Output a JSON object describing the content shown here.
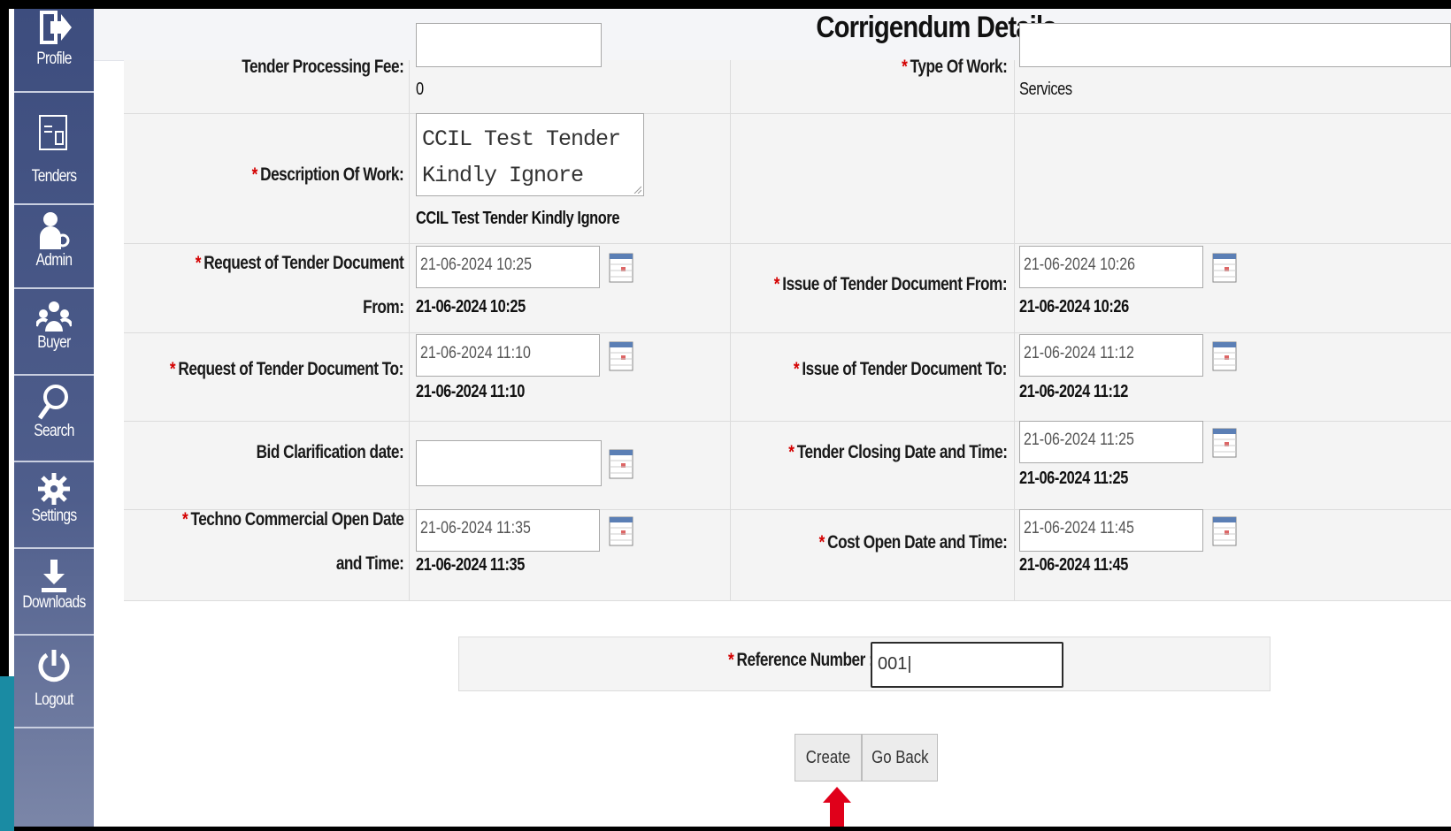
{
  "header": {
    "title": "Corrigendum Details"
  },
  "sidebar": {
    "items": [
      {
        "label": "Profile",
        "icon": "profile-icon"
      },
      {
        "label": "Tenders",
        "icon": "tenders-icon"
      },
      {
        "label": "Admin",
        "icon": "admin-icon"
      },
      {
        "label": "Buyer",
        "icon": "buyer-icon"
      },
      {
        "label": "Search",
        "icon": "search-icon"
      },
      {
        "label": "Settings",
        "icon": "settings-icon"
      },
      {
        "label": "Downloads",
        "icon": "downloads-icon"
      },
      {
        "label": "Logout",
        "icon": "logout-icon"
      }
    ]
  },
  "form": {
    "processing_fee": {
      "label": "Tender Processing Fee:",
      "value": "0"
    },
    "type_of_work": {
      "label": "Type Of Work:",
      "value": "Services"
    },
    "description": {
      "label": "Description Of Work:",
      "input_line1": "CCIL Test Tender",
      "input_line2": "Kindly Ignore",
      "value": "CCIL Test Tender Kindly Ignore"
    },
    "req_from": {
      "label_line1": "Request of Tender Document",
      "label_line2": "From:",
      "input": "21-06-2024 10:25",
      "value": "21-06-2024 10:25"
    },
    "issue_from": {
      "label": "Issue of Tender Document From:",
      "input": "21-06-2024 10:26",
      "value": "21-06-2024 10:26"
    },
    "req_to": {
      "label": "Request of Tender Document To:",
      "input": "21-06-2024 11:10",
      "value": "21-06-2024 11:10"
    },
    "issue_to": {
      "label": "Issue of Tender Document To:",
      "input": "21-06-2024 11:12",
      "value": "21-06-2024 11:12"
    },
    "bid_clarification": {
      "label": "Bid Clarification date:",
      "input": ""
    },
    "closing": {
      "label": "Tender Closing Date and Time:",
      "input": "21-06-2024 11:25",
      "value": "21-06-2024 11:25"
    },
    "techno_open": {
      "label_line1": "Techno Commercial Open Date",
      "label_line2": "and Time:",
      "input": "21-06-2024 11:35",
      "value": "21-06-2024 11:35"
    },
    "cost_open": {
      "label": "Cost Open Date and Time:",
      "input": "21-06-2024 11:45",
      "value": "21-06-2024 11:45"
    }
  },
  "reference": {
    "label": "Reference Number :",
    "value": "001"
  },
  "buttons": {
    "create": "Create",
    "go_back": "Go Back"
  },
  "colors": {
    "sidebar": "#4a5989",
    "required": "#d40000",
    "arrow": "#e0001a",
    "accent": "#1a8ba3"
  }
}
